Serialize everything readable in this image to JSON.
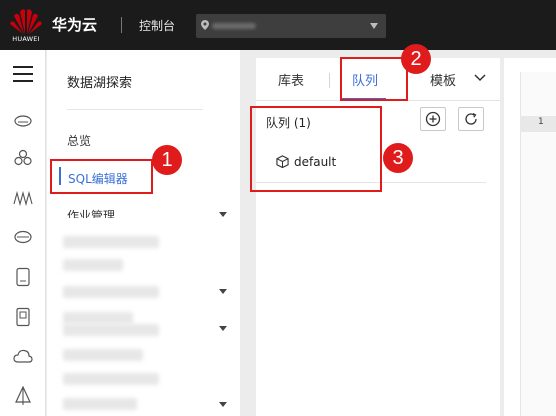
{
  "header": {
    "logo_text": "HUAWEI",
    "brand": "华为云",
    "console": "控制台",
    "brand_color": "#c7000b"
  },
  "sidebar": {
    "title": "数据湖探索",
    "items": [
      {
        "label": "总览"
      },
      {
        "label": "SQL编辑器",
        "active": true
      },
      {
        "label": "作业管理"
      }
    ],
    "active_color": "#3a6fd8"
  },
  "tabs": {
    "items": [
      {
        "label": "库表"
      },
      {
        "label": "队列",
        "active": true
      },
      {
        "label": "模板"
      }
    ]
  },
  "queue_panel": {
    "heading": "队列 (1)",
    "items": [
      {
        "label": "default",
        "icon": "cube-icon"
      }
    ],
    "add_icon": "plus-circle-icon",
    "refresh_icon": "refresh-icon"
  },
  "editor": {
    "line_numbers": [
      "1"
    ]
  },
  "annotations": {
    "badges": [
      "1",
      "2",
      "3"
    ],
    "color": "#e01b1b"
  }
}
